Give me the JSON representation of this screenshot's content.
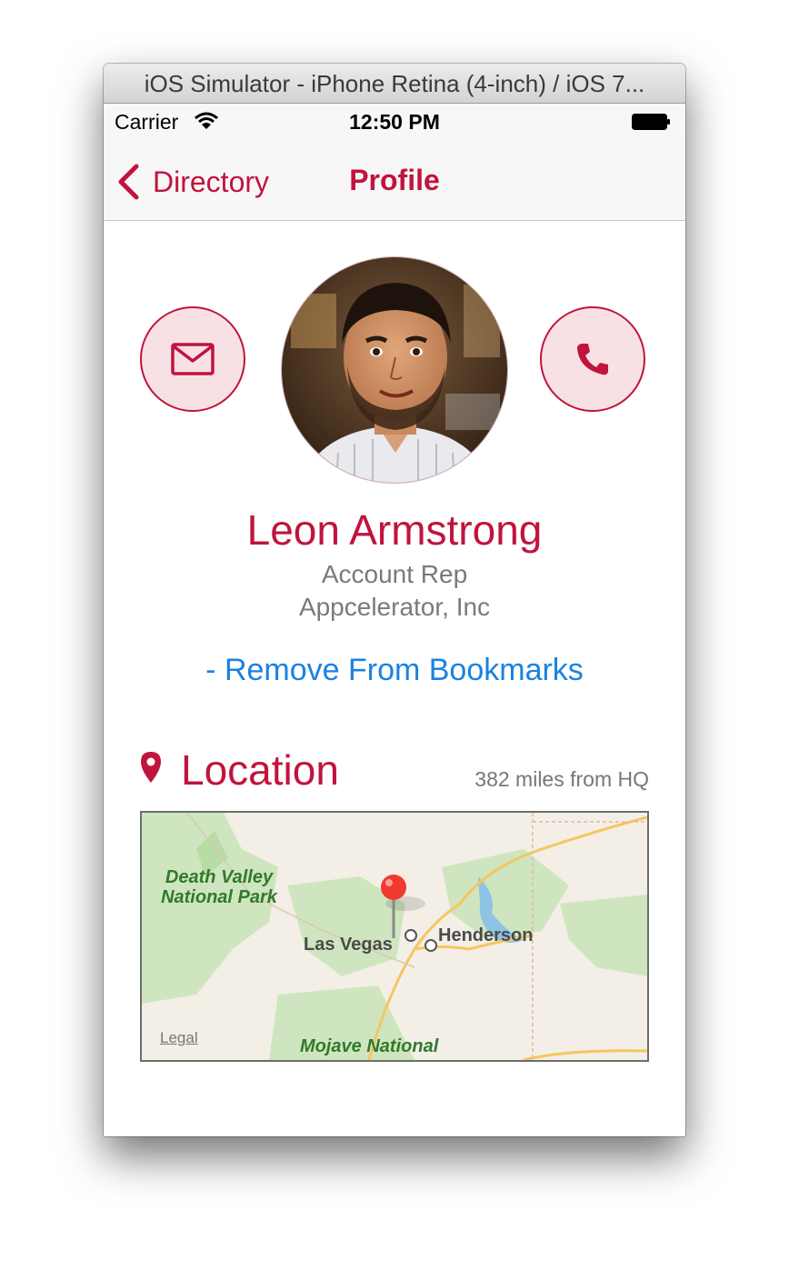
{
  "window": {
    "title": "iOS Simulator - iPhone Retina (4-inch) / iOS 7..."
  },
  "status_bar": {
    "carrier": "Carrier",
    "time": "12:50 PM"
  },
  "nav_bar": {
    "back_label": "Directory",
    "title": "Profile"
  },
  "profile": {
    "name": "Leon Armstrong",
    "job_title": "Account Rep",
    "company": "Appcelerator, Inc",
    "bookmark_action": "- Remove From Bookmarks"
  },
  "location": {
    "heading": "Location",
    "distance": "382 miles from HQ",
    "map": {
      "park_1": "Death Valley National Park",
      "park_2": "Mojave National",
      "city_1": "Las Vegas",
      "city_2": "Henderson",
      "legal": "Legal"
    }
  },
  "icons": {
    "back": "chevron-left-icon",
    "email": "envelope-icon",
    "phone": "phone-icon",
    "location": "map-pin-icon",
    "wifi": "wifi-icon",
    "battery": "battery-icon"
  },
  "colors": {
    "accent": "#c0143c",
    "link": "#1a82e2",
    "button_fill": "#f8e1e5",
    "secondary_text": "#7a7a7a"
  }
}
